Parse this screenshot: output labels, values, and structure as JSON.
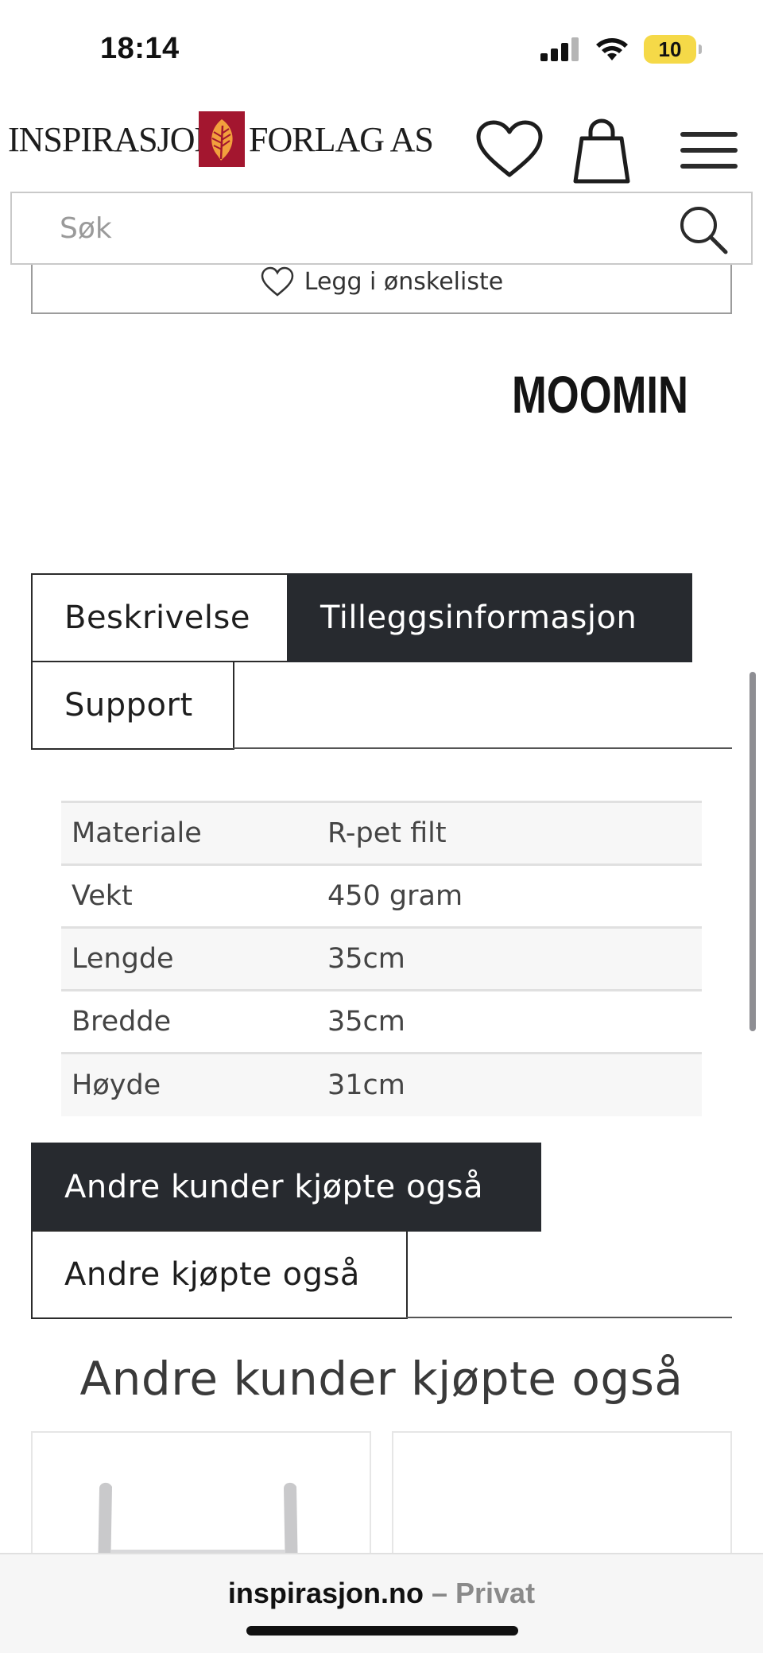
{
  "status_bar": {
    "time": "18:14",
    "battery": "10",
    "battery_color": "#f5d948"
  },
  "header": {
    "logo_left": "INSPIRASJON",
    "logo_right": "FORLAG AS",
    "logo_mark_color": "#a3162f",
    "icons": [
      "heart-icon",
      "shopping-bag-icon",
      "hamburger-menu-icon"
    ]
  },
  "search": {
    "placeholder": "Søk",
    "icon": "search-icon"
  },
  "product": {
    "wishlist_label": "Legg i ønskeliste",
    "brand": "MOOMIN"
  },
  "tabs": {
    "description": "Beskrivelse",
    "additional_info": "Tilleggsinformasjon",
    "support": "Support",
    "active": "Tilleggsinformasjon",
    "active_color": "#272a2f"
  },
  "attributes": [
    {
      "label": "Materiale",
      "value": "R-pet filt"
    },
    {
      "label": "Vekt",
      "value": "450 gram"
    },
    {
      "label": "Lengde",
      "value": "35cm"
    },
    {
      "label": "Bredde",
      "value": "35cm"
    },
    {
      "label": "Høyde",
      "value": "31cm"
    }
  ],
  "related_tabs": {
    "customers_also_bought": "Andre kunder kjøpte også",
    "others_also_bought": "Andre kjøpte også",
    "active": "Andre kunder kjøpte også"
  },
  "related": {
    "title": "Andre kunder kjøpte også"
  },
  "browser": {
    "domain": "inspirasjon.no",
    "separator": "–",
    "mode": "Privat"
  }
}
